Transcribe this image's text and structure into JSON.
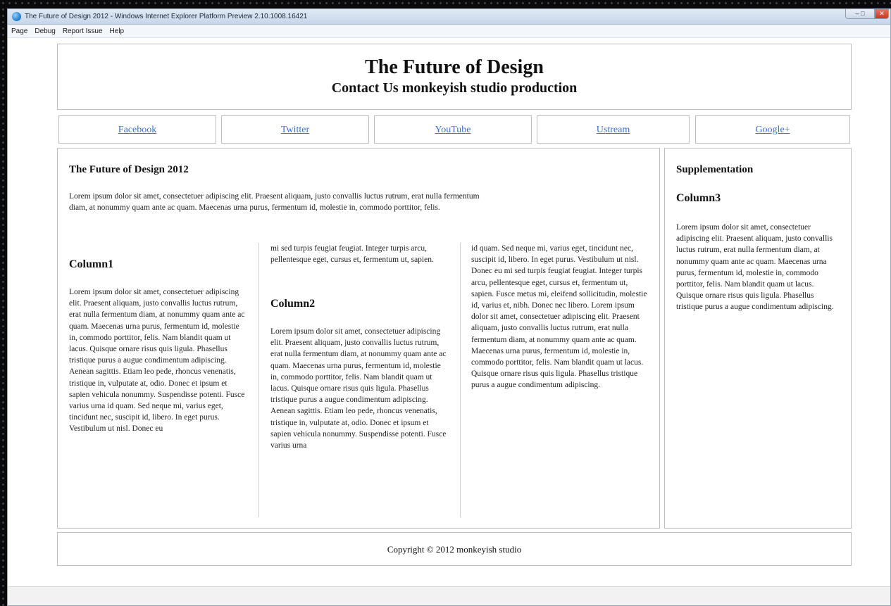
{
  "window": {
    "title": "The Future of Design 2012 - Windows Internet Explorer Platform Preview 2.10.1008.16421"
  },
  "menu": [
    "Page",
    "Debug",
    "Report Issue",
    "Help"
  ],
  "header": {
    "title": "The Future of Design",
    "subtitle": "Contact Us monkeyish studio production"
  },
  "nav": [
    "Facebook",
    "Twitter",
    "YouTube",
    "Ustream",
    "Google+"
  ],
  "main": {
    "title": "The Future of Design 2012",
    "intro": "Lorem ipsum dolor sit amet, consectetuer adipiscing elit. Praesent aliquam, justo convallis luctus rutrum, erat nulla fermentum diam, at nonummy quam ante ac quam. Maecenas urna purus, fermentum id, molestie in, commodo porttitor, felis.",
    "column1_heading": "Column1",
    "column1_text": "Lorem ipsum dolor sit amet, consectetuer adipiscing elit. Praesent aliquam, justo convallis luctus rutrum, erat nulla fermentum diam, at nonummy quam ante ac quam. Maecenas urna purus, fermentum id, molestie in, commodo porttitor, felis. Nam blandit quam ut lacus. Quisque ornare risus quis ligula. Phasellus tristique purus a augue condimentum adipiscing. Aenean sagittis. Etiam leo pede, rhoncus venenatis, tristique in, vulputate at, odio. Donec et ipsum et sapien vehicula nonummy. Suspendisse potenti. Fusce varius urna id quam. Sed neque mi, varius eget, tincidunt nec, suscipit id, libero. In eget purus. Vestibulum ut nisl. Donec eu",
    "column2_top": "mi sed turpis feugiat feugiat. Integer turpis arcu, pellentesque eget, cursus et, fermentum ut, sapien.",
    "column2_heading": "Column2",
    "column2_text": "Lorem ipsum dolor sit amet, consectetuer adipiscing elit. Praesent aliquam, justo convallis luctus rutrum, erat nulla fermentum diam, at nonummy quam ante ac quam. Maecenas urna purus, fermentum id, molestie in, commodo porttitor, felis. Nam blandit quam ut lacus. Quisque ornare risus quis ligula. Phasellus tristique purus a augue condimentum adipiscing. Aenean sagittis. Etiam leo pede, rhoncus venenatis, tristique in, vulputate at, odio. Donec et ipsum et sapien vehicula nonummy. Suspendisse potenti. Fusce varius urna",
    "column3_text": "id quam. Sed neque mi, varius eget, tincidunt nec, suscipit id, libero. In eget purus. Vestibulum ut nisl. Donec eu mi sed turpis feugiat feugiat. Integer turpis arcu, pellentesque eget, cursus et, fermentum ut, sapien. Fusce metus mi, eleifend sollicitudin, molestie id, varius et, nibh. Donec nec libero. Lorem ipsum dolor sit amet, consectetuer adipiscing elit. Praesent aliquam, justo convallis luctus rutrum, erat nulla fermentum diam, at nonummy quam ante ac quam. Maecenas urna purus, fermentum id, molestie in, commodo porttitor, felis. Nam blandit quam ut lacus. Quisque ornare risus quis ligula. Phasellus tristique purus a augue condimentum adipiscing."
  },
  "aside": {
    "title": "Supplementation",
    "heading": "Column3",
    "text": "Lorem ipsum dolor sit amet, consectetuer adipiscing elit. Praesent aliquam, justo convallis luctus rutrum, erat nulla fermentum diam, at nonummy quam ante ac quam. Maecenas urna purus, fermentum id, molestie in, commodo porttitor, felis. Nam blandit quam ut lacus. Quisque ornare risus quis ligula. Phasellus tristique purus a augue condimentum adipiscing."
  },
  "footer": {
    "copyright": "Copyright © 2012 monkeyish studio"
  },
  "colors": {
    "link": "#3b6fd0",
    "border": "#bdbdbd",
    "titlebar": "#c7d6ea"
  }
}
